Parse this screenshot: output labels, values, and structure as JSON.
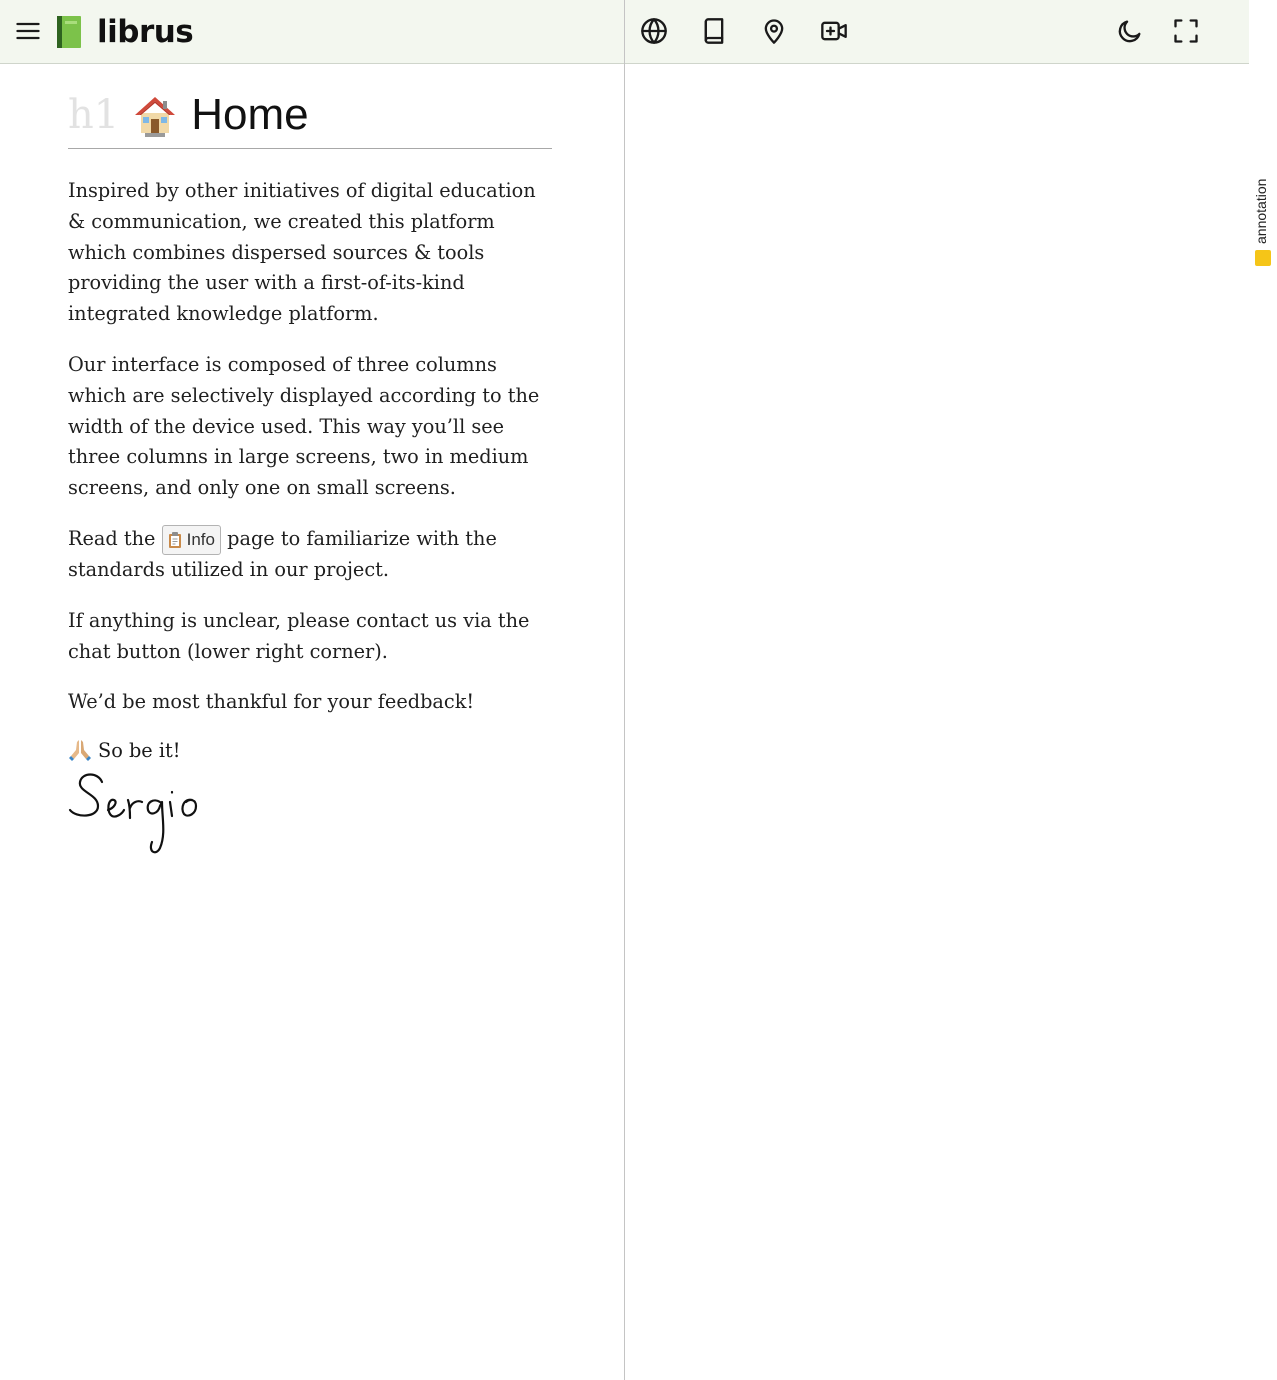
{
  "app": {
    "logo_text": "librus",
    "logo_icon": "green-book-icon"
  },
  "toolbar_left": {
    "menu_icon": "hamburger-menu-icon"
  },
  "toolbar_right": {
    "icons": [
      "globe-icon",
      "book-icon",
      "map-pin-icon",
      "video-plus-icon",
      "moon-icon",
      "fullscreen-icon"
    ]
  },
  "page": {
    "heading_tag": "h1",
    "title": "Home",
    "title_icon": "house-icon",
    "paragraphs": [
      "Inspired by other initiatives of digital education & communication, we created this platform which combines dispersed sources & tools providing the user with a first-of-its-kind integrated knowledge platform.",
      "Our interface is composed of three columns which are selectively displayed according to the width of the device used. This way you’ll see three columns in large screens, two in medium screens, and only one on small screens."
    ],
    "read_prefix": "Read the",
    "info_chip_label": "Info",
    "info_chip_icon": "clipboard-icon",
    "read_suffix": "page to familiarize with the standards utilized in our project.",
    "contact_text": "If anything is unclear, please contact us via the chat button (lower right corner).",
    "feedback_text": "We’d be most thankful for your feedback!",
    "signoff_text": "So be it!",
    "signoff_icon": "praying-hands-icon",
    "signature_text": "Sergio"
  },
  "side_tab": {
    "label": "annotation",
    "color": "#f5c518"
  },
  "colors": {
    "topbar_bg": "#f3f7ef",
    "divider": "#c4c4c4"
  }
}
